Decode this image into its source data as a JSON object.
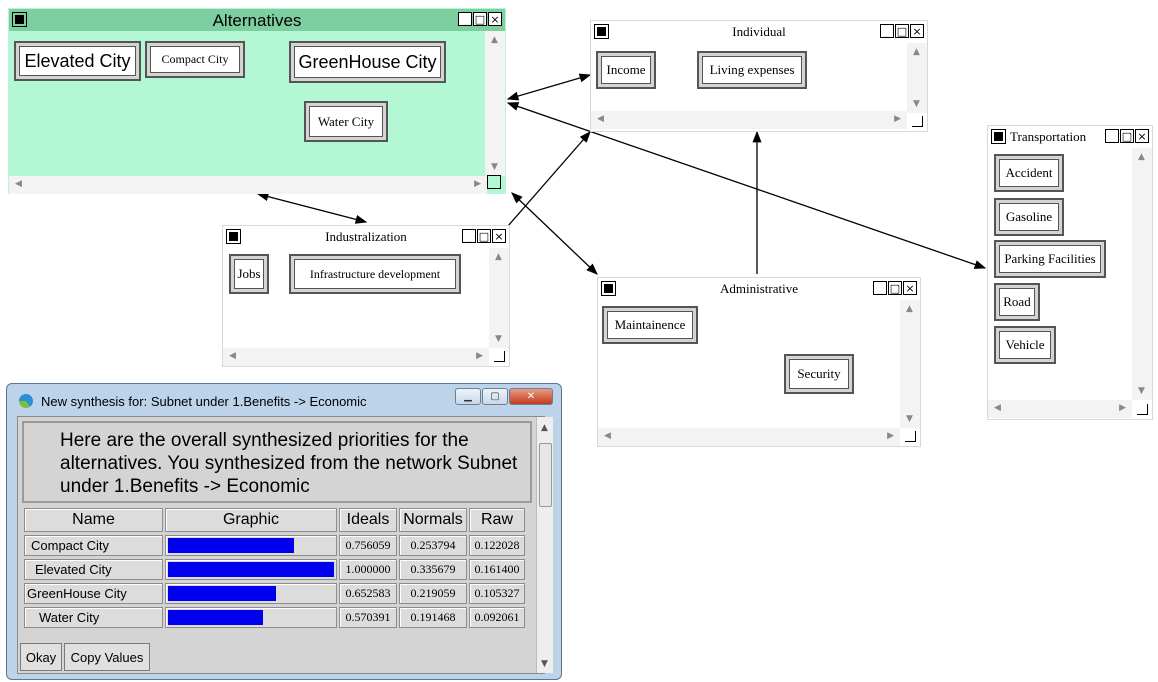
{
  "clusters": {
    "alternatives": {
      "title": "Alternatives",
      "nodes": [
        "Elevated City",
        "Compact City",
        "GreenHouse City",
        "Water City"
      ]
    },
    "individual": {
      "title": "Individual",
      "nodes": [
        "Income",
        "Living expenses"
      ]
    },
    "industralization": {
      "title": "Industralization",
      "nodes": [
        "Jobs",
        "Infrastructure development"
      ]
    },
    "administrative": {
      "title": "Administrative",
      "nodes": [
        "Maintainence",
        "Security"
      ]
    },
    "transportation": {
      "title": "Transportation",
      "nodes": [
        "Accident",
        "Gasoline",
        "Parking Facilities",
        "Road",
        "Vehicle"
      ]
    }
  },
  "window_buttons": {
    "minimize": "_",
    "maximize": "□",
    "close": "×"
  },
  "dialog": {
    "title": "New synthesis for: Subnet under 1.Benefits -> Economic",
    "message": "Here are the overall synthesized priorities for the alternatives.  You synthesized from the network Subnet under 1.Benefits -> Economic",
    "headers": [
      "Name",
      "Graphic",
      "Ideals",
      "Normals",
      "Raw"
    ],
    "rows": [
      {
        "name": "Compact City",
        "ideal": "0.756059",
        "normal": "0.253794",
        "raw": "0.122028",
        "bar": 0.756059
      },
      {
        "name": "Elevated City",
        "ideal": "1.000000",
        "normal": "0.335679",
        "raw": "0.161400",
        "bar": 1.0
      },
      {
        "name": "GreenHouse City",
        "ideal": "0.652583",
        "normal": "0.219059",
        "raw": "0.105327",
        "bar": 0.652583
      },
      {
        "name": "Water City",
        "ideal": "0.570391",
        "normal": "0.191468",
        "raw": "0.092061",
        "bar": 0.570391
      }
    ],
    "buttons": {
      "okay": "Okay",
      "copy": "Copy Values"
    },
    "bar_color": "#0000ee"
  },
  "colors": {
    "alternatives_bg": "#b3f7d5",
    "alternatives_title": "#7dcfa0"
  }
}
